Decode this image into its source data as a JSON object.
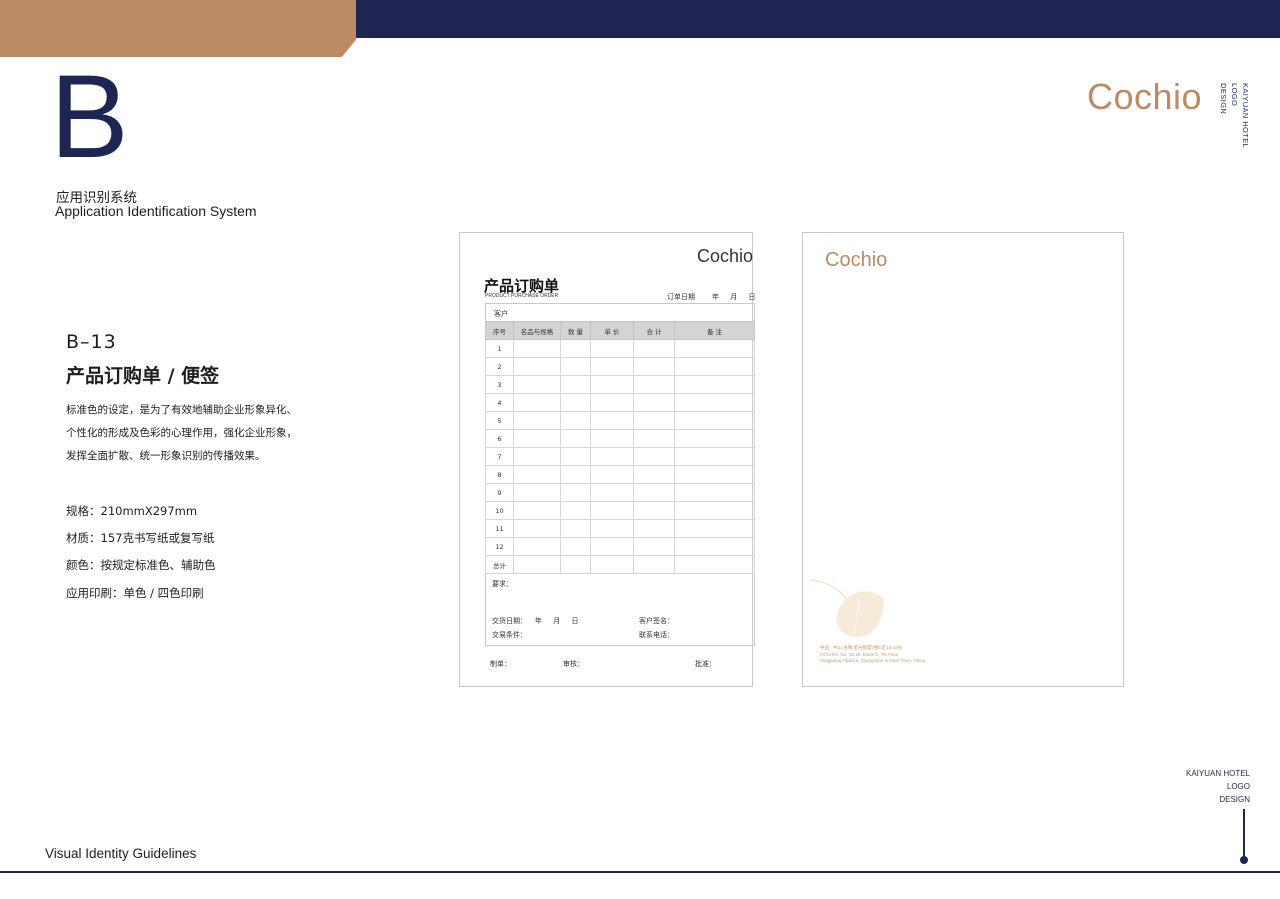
{
  "header": {
    "brand_copper": "#bd8a66",
    "brand_navy": "#1f2553"
  },
  "section": {
    "letter": "B",
    "title_cn": "应用识别系统",
    "title_en": "Application Identification System"
  },
  "brand": {
    "logo": "Cochio",
    "vertical_lines": [
      "KAIYUAN HOTEL",
      "LOGO",
      "DESIGN"
    ]
  },
  "item": {
    "code": "B–13",
    "title": "产品订购单 / 便签",
    "description": [
      "标准色的设定，是为了有效地辅助企业形象异化、",
      "个性化的形成及色彩的心理作用，强化企业形象，",
      "发挥全面扩散、统一形象识别的传播效果。"
    ],
    "specs": [
      "规格：210mmX297mm",
      "材质：157克书写纸或复写纸",
      "颜色：按规定标准色、辅助色",
      "应用印刷：单色 / 四色印刷"
    ]
  },
  "order_form": {
    "logo": "Cochio",
    "title": "产品订购单",
    "subtitle": "PRODUCT PURCHASE ORDER",
    "date_label": "订单日期",
    "date_units": "年 月 日",
    "customer_label": "客户",
    "columns": [
      "序号",
      "名品与规格",
      "数  量",
      "单  价",
      "合  计",
      "备    注"
    ],
    "rows": [
      "1",
      "2",
      "3",
      "4",
      "5",
      "6",
      "7",
      "8",
      "9",
      "10",
      "11",
      "12"
    ],
    "total_label": "总计",
    "requirements_label": "要求：",
    "delivery_date_label": "交货日期：",
    "delivery_date_units": "年 月 日",
    "delivery_terms_label": "交易条件：",
    "customer_sign_label": "客户签名：",
    "contact_phone_label": "联系电话：",
    "made_by_label": "制单：",
    "reviewed_label": "审核：",
    "approved_label": "批准："
  },
  "notepad": {
    "logo": "Cochio",
    "address_lines": [
      "中国 · 中山 古镇 星光联盟7楼C区15-19号",
      "COCHIO, No. 15-19, Block C, 7th Floor",
      "Xingguang Alliance, Zhongshan Ancient Town, China"
    ]
  },
  "corner": {
    "lines": [
      "KAIYUAN HOTEL",
      "LOGO",
      "DESIGN"
    ]
  },
  "footer": {
    "text": "Visual Identity Guidelines"
  }
}
